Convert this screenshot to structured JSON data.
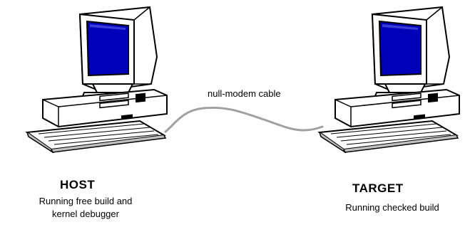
{
  "cable": {
    "label": "null-modem cable",
    "color": "#a0a0a0"
  },
  "host": {
    "title": "HOST",
    "description_line1": "Running free build and",
    "description_line2": "kernel debugger"
  },
  "target": {
    "title": "TARGET",
    "description_line1": "Running checked build"
  },
  "colors": {
    "screen": "#0000b8",
    "outline": "#000000",
    "fill": "#ffffff",
    "shade": "#c0c0c0"
  }
}
